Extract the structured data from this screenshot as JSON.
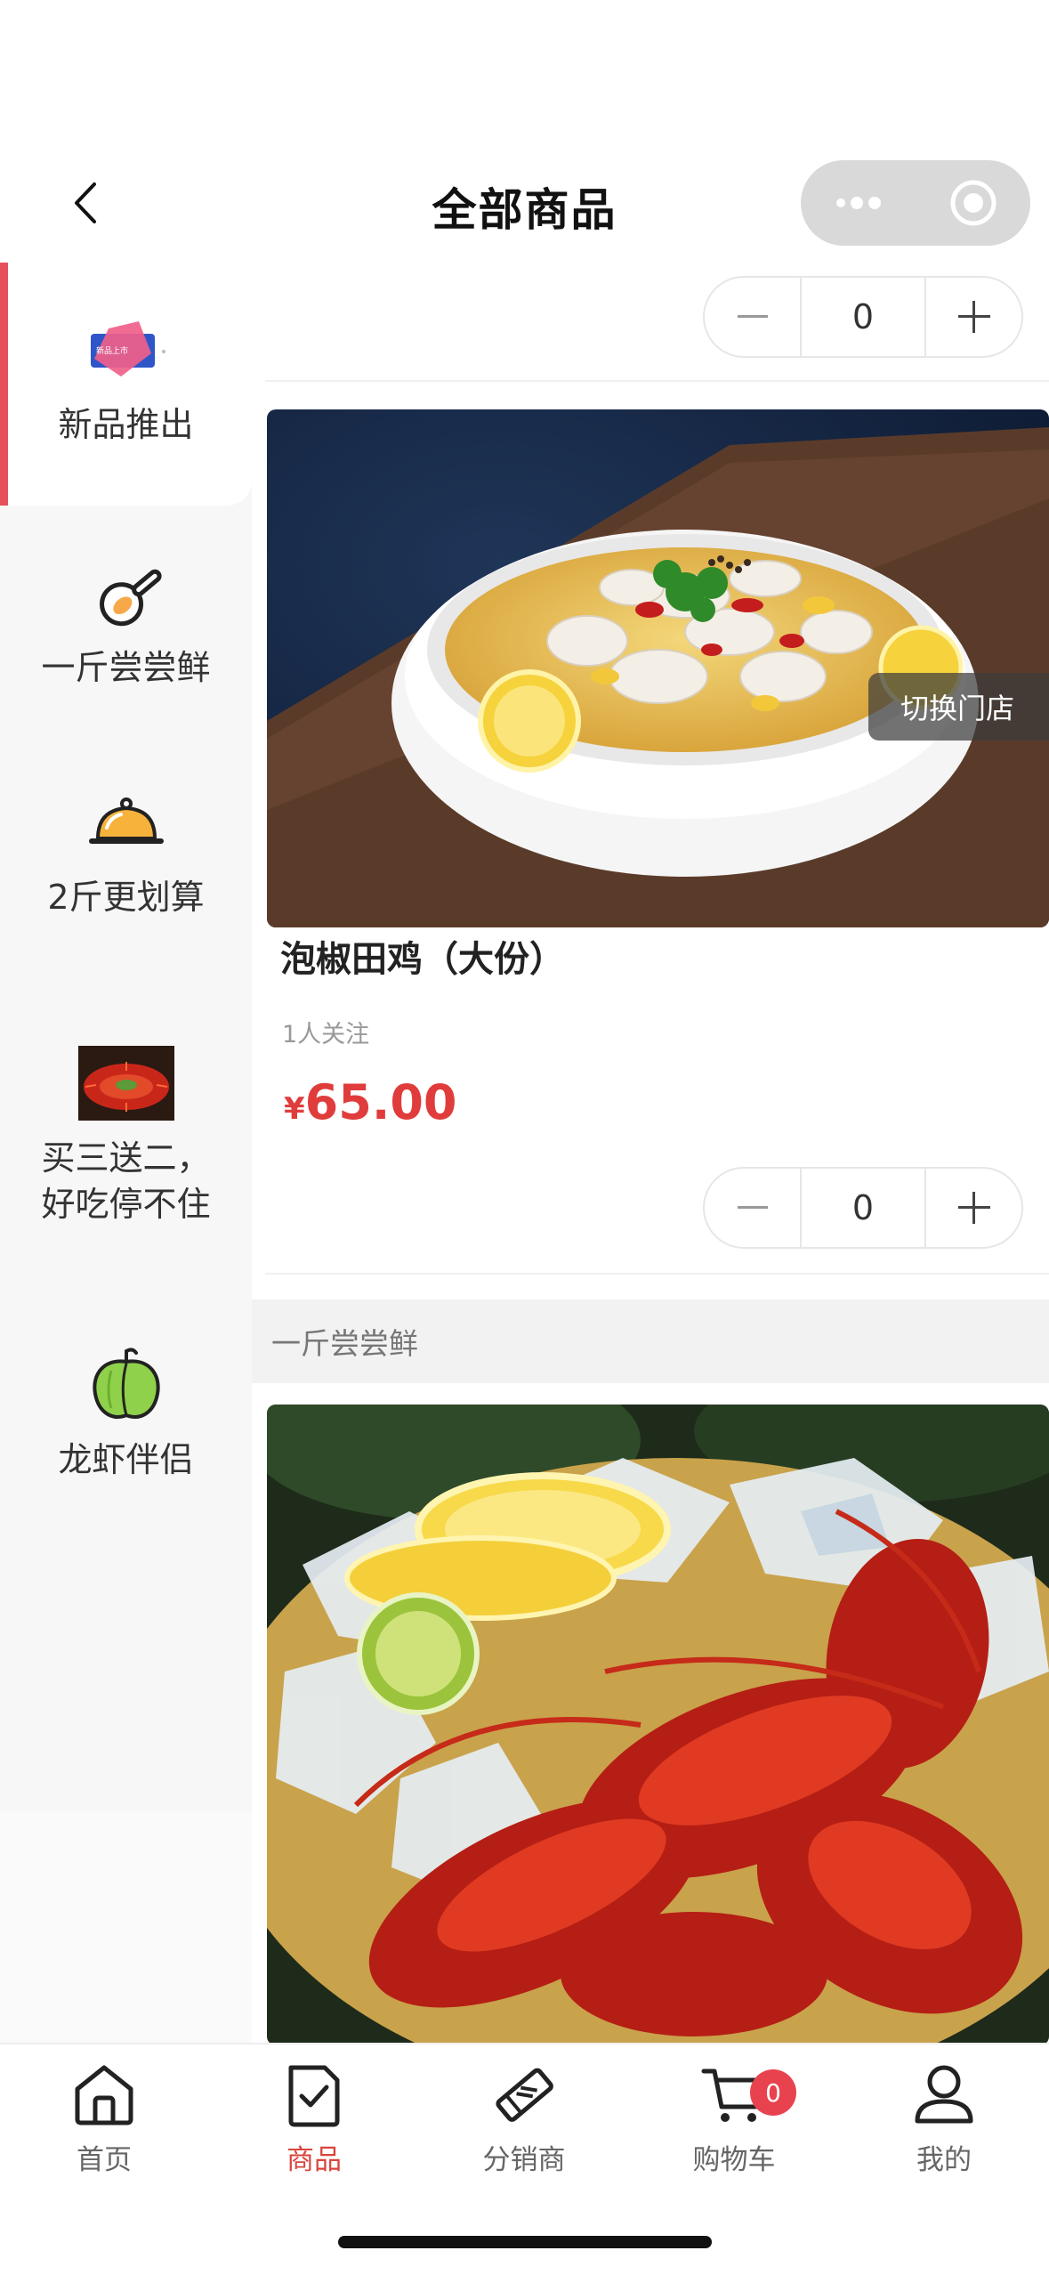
{
  "navbar": {
    "title": "全部商品"
  },
  "sidebar": {
    "categories": [
      {
        "label": "新品推出",
        "icon": "new-product-badge-icon",
        "active": true
      },
      {
        "label": "一斤尝尝鲜",
        "icon": "frying-pan-icon"
      },
      {
        "label": "2斤更划算",
        "icon": "cloche-icon"
      },
      {
        "label": "买三送二，好吃停不住",
        "label_line1": "买三送二，",
        "label_line2": "好吃停不住",
        "icon": "crayfish-thumbnail-icon"
      },
      {
        "label": "龙虾伴侣",
        "icon": "bell-pepper-icon"
      }
    ]
  },
  "content": {
    "top_stepper": {
      "qty": "0"
    },
    "products": [
      {
        "name": "泡椒田鸡（大份）",
        "follow": "1人关注",
        "currency": "¥",
        "price": "65.00",
        "qty": "0",
        "image": "pickled-pepper-frog-dish"
      }
    ],
    "switch_store": "切换门店",
    "sections": [
      {
        "title": "一斤尝尝鲜"
      }
    ]
  },
  "tabbar": {
    "items": [
      {
        "label": "首页",
        "icon": "home-icon"
      },
      {
        "label": "商品",
        "icon": "goods-icon",
        "active": true
      },
      {
        "label": "分销商",
        "icon": "handshake-icon"
      },
      {
        "label": "购物车",
        "icon": "cart-icon",
        "badge": "0"
      },
      {
        "label": "我的",
        "icon": "user-icon"
      }
    ]
  },
  "colors": {
    "accent": "#e8505b",
    "price": "#e03c3c",
    "active_tab": "#d9453d",
    "badge": "#e8424f"
  }
}
